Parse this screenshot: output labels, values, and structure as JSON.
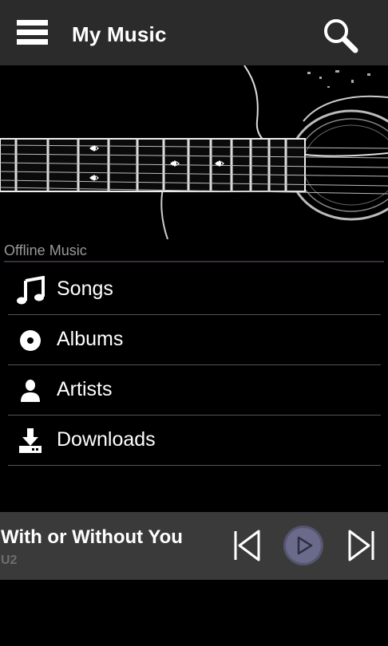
{
  "header": {
    "title": "My Music",
    "menu_icon": "hamburger-menu-icon",
    "search_icon": "search-icon"
  },
  "hero": {
    "image": "acoustic-guitar-fretboard"
  },
  "section": {
    "label": "Offline Music"
  },
  "menu": {
    "items": [
      {
        "label": "Songs",
        "icon": "music-note-icon"
      },
      {
        "label": "Albums",
        "icon": "disc-icon"
      },
      {
        "label": "Artists",
        "icon": "person-icon"
      },
      {
        "label": "Downloads",
        "icon": "download-icon"
      }
    ]
  },
  "player": {
    "song_title": "With or Without You",
    "artist": "U2",
    "controls": [
      "previous-icon",
      "play-icon",
      "next-icon"
    ],
    "accent_color": "#5a5a7a"
  }
}
